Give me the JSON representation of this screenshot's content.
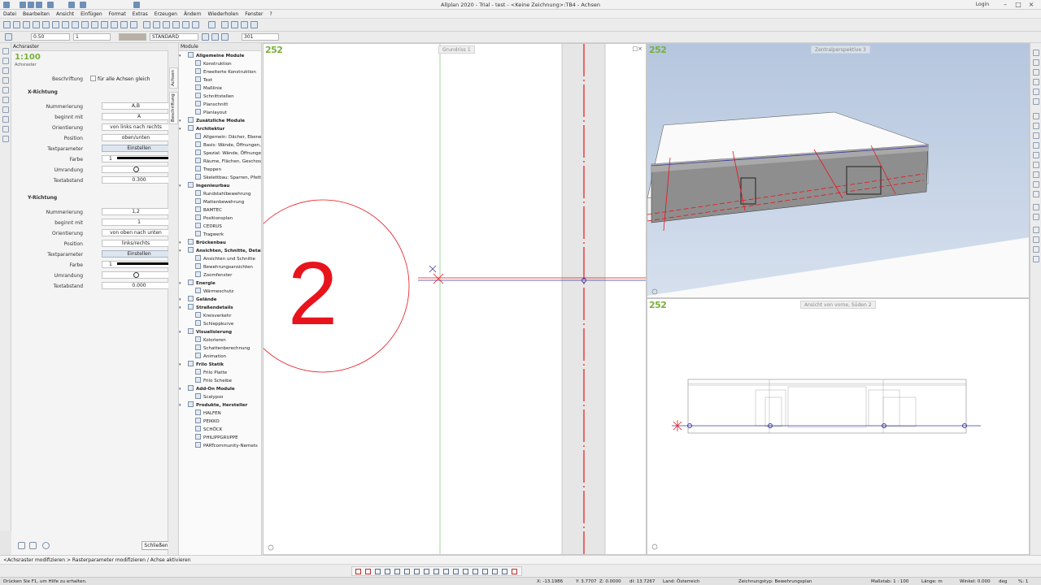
{
  "window": {
    "title": "Allplan 2020 - Trial - test - <Keine Zeichnung>:TB4 - Achsen",
    "login_label": "Login"
  },
  "menu": [
    "Datei",
    "Bearbeiten",
    "Ansicht",
    "Einfügen",
    "Format",
    "Extras",
    "Erzeugen",
    "Ändern",
    "Wiederholen",
    "Fenster",
    "?"
  ],
  "format_bar": {
    "pen_value": "0.50",
    "line_value": "1",
    "layer_value": "STANDARD",
    "number_value": "301"
  },
  "properties_panel": {
    "title": "Achsraster",
    "scale_logo": "1:100",
    "logo_caption": "Achsraster",
    "beschriftung_label": "Beschriftung",
    "beschriftung_checkbox": "für alle Achsen gleich",
    "x_section": "X-Richtung",
    "y_section": "Y-Richtung",
    "x": {
      "nummerierung": "A,B",
      "beginnt_mit": "A",
      "orientierung": "von links nach rechts",
      "position": "oben/unten",
      "textparameter": "Einstellen",
      "farbe": "1",
      "textabstand": "0.300"
    },
    "y": {
      "nummerierung": "1,2",
      "beginnt_mit": "1",
      "orientierung": "von oben nach unten",
      "position": "links/rechts",
      "textparameter": "Einstellen",
      "farbe": "1",
      "textabstand": "0.000"
    },
    "labels": {
      "nummerierung": "Nummerierung",
      "beginnt_mit": "beginnt mit",
      "orientierung": "Orientierung",
      "position": "Position",
      "textparameter": "Textparameter",
      "farbe": "Farbe",
      "umrandung": "Umrandung",
      "textabstand": "Textabstand"
    },
    "close_button": "Schließen"
  },
  "vertical_tabs": [
    "Achsen",
    "Beschriftung"
  ],
  "modules_panel": {
    "title": "Module",
    "items": [
      {
        "label": "Allgemeine Module",
        "group": true
      },
      {
        "label": "Konstruktion",
        "group": false
      },
      {
        "label": "Erweiterte Konstruktion",
        "group": false
      },
      {
        "label": "Text",
        "group": false
      },
      {
        "label": "Maßlinie",
        "group": false
      },
      {
        "label": "Schnittstellen",
        "group": false
      },
      {
        "label": "Planschnitt",
        "group": false
      },
      {
        "label": "Planlayout",
        "group": false
      },
      {
        "label": "Zusätzliche Module",
        "group": true
      },
      {
        "label": "Architektur",
        "group": true
      },
      {
        "label": "Allgemein: Dächer, Ebene",
        "group": false
      },
      {
        "label": "Basis: Wände, Öffnungen,",
        "group": false
      },
      {
        "label": "Spezial: Wände, Öffnunge",
        "group": false
      },
      {
        "label": "Räume, Flächen, Geschos",
        "group": false
      },
      {
        "label": "Treppen",
        "group": false
      },
      {
        "label": "Skelettbau: Sparren, Pfette",
        "group": false
      },
      {
        "label": "Ingenieurbau",
        "group": true
      },
      {
        "label": "Rundstahlbewehrung",
        "group": false
      },
      {
        "label": "Mattenbewehrung",
        "group": false
      },
      {
        "label": "BAMTEC",
        "group": false
      },
      {
        "label": "Positionsplan",
        "group": false
      },
      {
        "label": "CEDRUS",
        "group": false
      },
      {
        "label": "Tragwerk",
        "group": false
      },
      {
        "label": "Brückenbau",
        "group": true
      },
      {
        "label": "Ansichten, Schnitte, Details",
        "group": true
      },
      {
        "label": "Ansichten und Schnitte",
        "group": false
      },
      {
        "label": "Bewehrungsansichten",
        "group": false
      },
      {
        "label": "Zoomfenster",
        "group": false
      },
      {
        "label": "Energie",
        "group": true
      },
      {
        "label": "Wärmeschutz",
        "group": false
      },
      {
        "label": "Gelände",
        "group": true
      },
      {
        "label": "Straßendetails",
        "group": true
      },
      {
        "label": "Kreisverkehr",
        "group": false
      },
      {
        "label": "Schleppkurve",
        "group": false
      },
      {
        "label": "Visualisierung",
        "group": true
      },
      {
        "label": "Kolorieren",
        "group": false
      },
      {
        "label": "Schattenberechnung",
        "group": false
      },
      {
        "label": "Animation",
        "group": false
      },
      {
        "label": "Frilo Statik",
        "group": true
      },
      {
        "label": "Frilo Platte",
        "group": false
      },
      {
        "label": "Frilo Scheibe",
        "group": false
      },
      {
        "label": "Add-On Module",
        "group": true
      },
      {
        "label": "Scalypso",
        "group": false
      },
      {
        "label": "Produkte, Hersteller",
        "group": true
      },
      {
        "label": "HALFEN",
        "group": false
      },
      {
        "label": "PEIKKO",
        "group": false
      },
      {
        "label": "SCHÖCK",
        "group": false
      },
      {
        "label": "PHILIPPGRUPPE",
        "group": false
      },
      {
        "label": "PARTcommunity-Nemets",
        "group": false
      }
    ]
  },
  "viewports": {
    "plan": {
      "label": "Grundriss 1",
      "scale": "252",
      "axis_label": "2"
    },
    "perspective": {
      "label": "Zentralperspektive 3",
      "scale": "252"
    },
    "elevation": {
      "label": "Ansicht von vorne, Süden 2",
      "scale": "252"
    }
  },
  "command_line": "<Achsraster modifizieren > Rasterparameter modifizieren / Achse aktivieren",
  "statusbar": {
    "hint": "Drücken Sie F1, um Hilfe zu erhalten.",
    "x": "X: -13.1986",
    "y": "Y: 3.7707",
    "z": "Z: 0.0000",
    "dl": "dl: 13.7267",
    "land": "Land: Österreich",
    "zeichnungstyp": "Zeichnungstyp: Bewehrungsplan",
    "massstab": "Maßstab: 1 : 100",
    "laenge": "Länge: m",
    "winkel": "Winkel: 0.000",
    "deg": "deg",
    "percent": "%: 1"
  },
  "colors": {
    "axis_red": "#e8141c",
    "axis_blue": "#3a3aa0",
    "scale_green": "#7ab03c",
    "perspective_bg": "#c4d2e6"
  }
}
